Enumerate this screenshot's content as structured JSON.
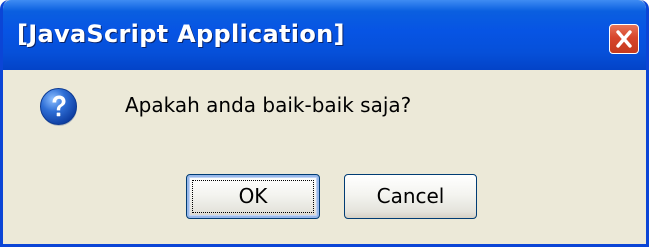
{
  "window": {
    "title": "[JavaScript Application]",
    "close_icon": "close-icon"
  },
  "dialog": {
    "icon": "question-icon",
    "message": "Apakah anda baik-baik saja?"
  },
  "buttons": {
    "ok_label": "OK",
    "cancel_label": "Cancel"
  },
  "colors": {
    "titlebar": "#0754e4",
    "window_border": "#0b45d6",
    "dialog_background": "#ece9d8",
    "close_button": "#d7452b",
    "question_icon": "#2f6fd6"
  }
}
